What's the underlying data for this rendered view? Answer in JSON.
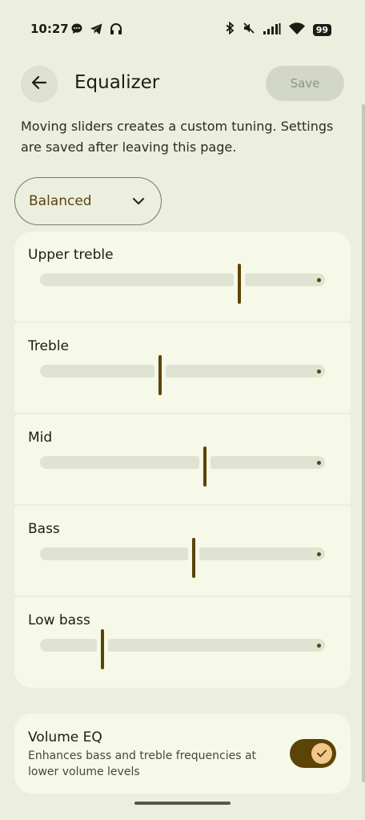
{
  "status_bar": {
    "time": "10:27",
    "left_icons": [
      "message-icon",
      "telegram-icon",
      "headphones-icon"
    ],
    "right_icons": [
      "bluetooth-icon",
      "mute-icon",
      "signal-icon",
      "wifi-icon"
    ],
    "battery": "99"
  },
  "app_bar": {
    "title": "Equalizer",
    "save_label": "Save"
  },
  "description": "Moving sliders creates a custom tuning. Settings are saved after leaving this page.",
  "preset": {
    "selected": "Balanced"
  },
  "bands": [
    {
      "label": "Upper treble",
      "level": 0.7
    },
    {
      "label": "Treble",
      "level": 0.42
    },
    {
      "label": "Mid",
      "level": 0.58
    },
    {
      "label": "Bass",
      "level": 0.54
    },
    {
      "label": "Low bass",
      "level": 0.22
    }
  ],
  "volume_eq": {
    "title": "Volume EQ",
    "description": "Enhances bass and treble frequencies at lower volume levels",
    "enabled": true
  },
  "colors": {
    "accent": "#5c4306",
    "background": "#ecefdd",
    "card": "#f6f9e8",
    "track": "#dfe3d2"
  }
}
